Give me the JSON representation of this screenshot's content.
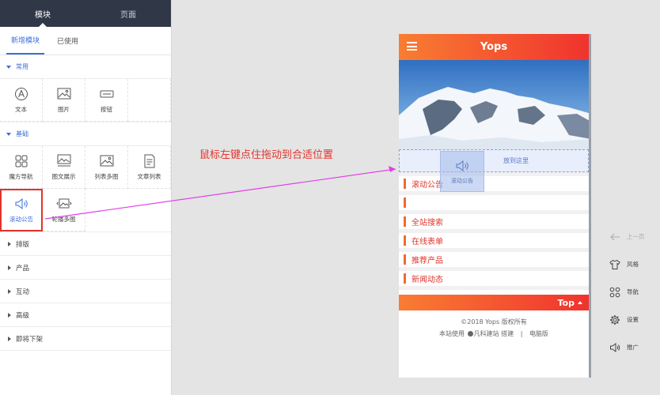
{
  "left_panel": {
    "top_tabs": [
      "模块",
      "页面"
    ],
    "sub_tabs": [
      "新增模块",
      "已使用"
    ],
    "sections": [
      {
        "title": "常用",
        "items": [
          {
            "label": "文本",
            "icon": "text-a-icon"
          },
          {
            "label": "图片",
            "icon": "image-icon"
          },
          {
            "label": "按钮",
            "icon": "button-icon"
          }
        ]
      },
      {
        "title": "基础",
        "items": [
          {
            "label": "魔方导航",
            "icon": "cube-nav-icon"
          },
          {
            "label": "图文展示",
            "icon": "image-text-icon"
          },
          {
            "label": "列表多图",
            "icon": "list-images-icon"
          },
          {
            "label": "文章列表",
            "icon": "article-list-icon"
          },
          {
            "label": "滚动公告",
            "icon": "speaker-icon"
          },
          {
            "label": "轮播多图",
            "icon": "carousel-icon"
          }
        ]
      }
    ],
    "collapsed_sections": [
      "排版",
      "产品",
      "互动",
      "高级",
      "即将下架"
    ]
  },
  "instruction_text": "鼠标左键点住拖动到合适位置",
  "phone": {
    "site_title": "Yops",
    "drop_label": "放到这里",
    "drag_ghost_label": "滚动公告",
    "modules": [
      "滚动公告",
      "",
      "全站搜索",
      "在线表单",
      "推荐产品",
      "新闻动态"
    ],
    "top_button": "Top",
    "copyright": "©2018 Yops 版权所有",
    "powered_by": "本站使用",
    "builder": "凡科建站 搭建",
    "separator": "|",
    "pc_version": "电脑版"
  },
  "right_tools": [
    {
      "label": "上一页",
      "icon": "back-arrow-icon",
      "disabled": true
    },
    {
      "label": "风格",
      "icon": "shirt-icon"
    },
    {
      "label": "导航",
      "icon": "nav-grid-icon"
    },
    {
      "label": "设置",
      "icon": "gear-icon"
    },
    {
      "label": "推广",
      "icon": "speaker-icon"
    }
  ],
  "colors": {
    "accent_blue": "#3b6fd8",
    "header_gradient_start": "#f97d32",
    "header_gradient_end": "#f0332e",
    "instruction_red": "#e3342c",
    "arrow_magenta": "#e040e8"
  }
}
